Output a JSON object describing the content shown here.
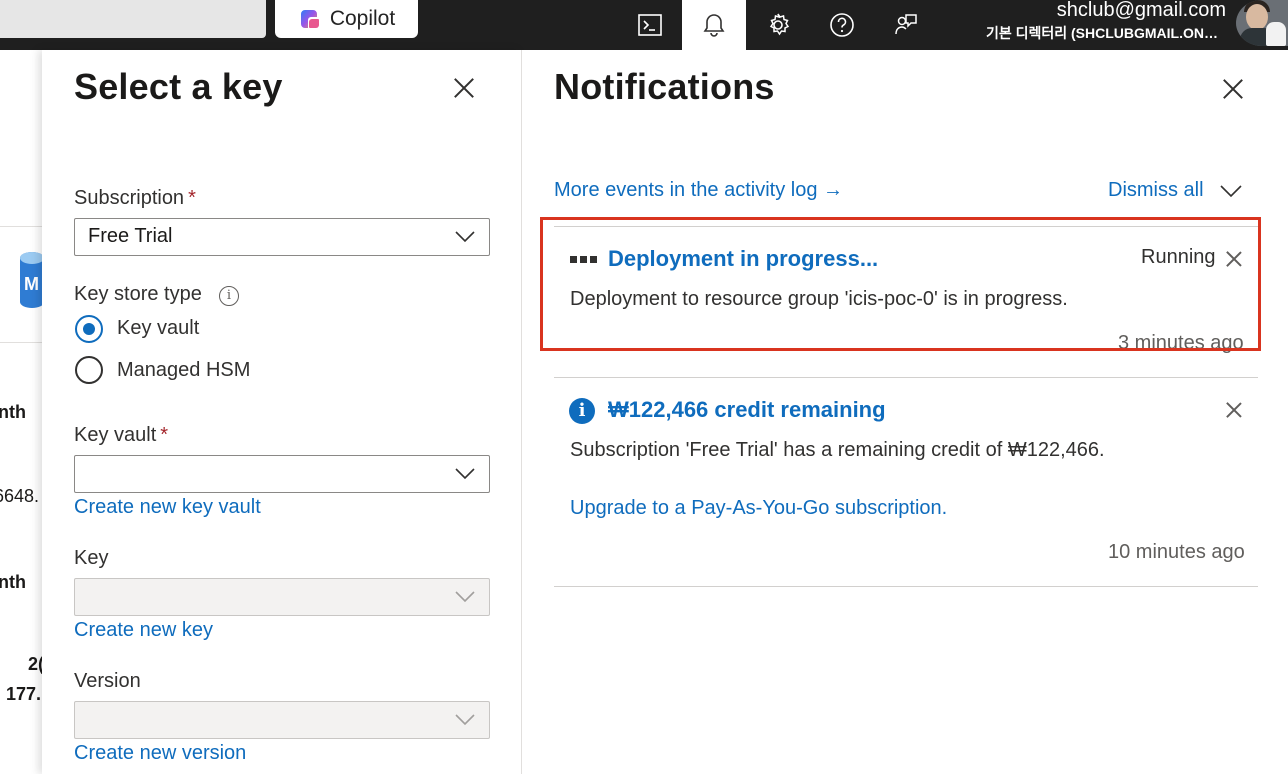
{
  "topbar": {
    "copilot_label": "Copilot",
    "icons": [
      "terminal-icon",
      "bell-icon",
      "gear-icon",
      "help-icon",
      "feedback-icon"
    ],
    "account_email": "shclub@gmail.com",
    "account_directory": "기본 디렉터리 (SHCLUBGMAIL.ON…"
  },
  "background_page": {
    "texts": [
      "nth",
      "6648.",
      "nth",
      "2(",
      "177."
    ]
  },
  "select_key": {
    "title": "Select a key",
    "subscription": {
      "label": "Subscription",
      "required_mark": "*",
      "value": "Free Trial"
    },
    "key_store_type": {
      "label": "Key store type",
      "info_glyph": "i",
      "options": [
        {
          "label": "Key vault",
          "selected": true
        },
        {
          "label": "Managed HSM",
          "selected": false
        }
      ]
    },
    "key_vault": {
      "label": "Key vault",
      "required_mark": "*",
      "value": "",
      "create_link": "Create new key vault"
    },
    "key": {
      "label": "Key",
      "value": "",
      "create_link": "Create new key"
    },
    "version": {
      "label": "Version",
      "value": "",
      "create_link": "Create new version"
    }
  },
  "notifications": {
    "title": "Notifications",
    "activity_log_link": "More events in the activity log →",
    "dismiss_all": "Dismiss all",
    "items": [
      {
        "title": "Deployment in progress...",
        "status": "Running",
        "body": "Deployment to resource group 'icis-poc-0' is in progress.",
        "time": "3 minutes ago"
      },
      {
        "info_glyph": "i",
        "title": "₩122,466 credit remaining",
        "body": "Subscription 'Free Trial' has a remaining credit of ₩122,466.",
        "link": "Upgrade to a Pay-As-You-Go subscription.",
        "time": "10 minutes ago"
      }
    ]
  },
  "colors": {
    "accent": "#0f6cbd",
    "topbar": "#1f1f1f",
    "highlight": "#d9341f",
    "required": "#a4262c"
  }
}
